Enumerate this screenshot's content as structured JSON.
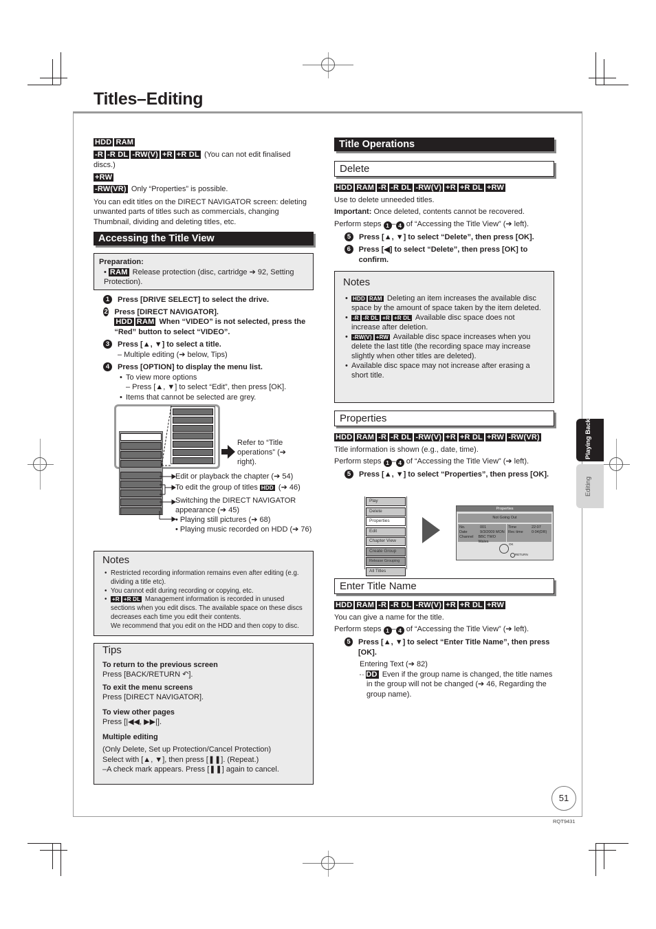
{
  "page": {
    "title": "Titles–Editing",
    "page_number": "51",
    "doc_code": "RQT9431"
  },
  "side_tabs": [
    {
      "label": "Playing Back",
      "active": true
    },
    {
      "label": "Editing",
      "active": false
    }
  ],
  "left": {
    "intro": {
      "row1_tags": [
        "HDD",
        "RAM"
      ],
      "row2_tags": [
        "-R",
        "-R DL",
        "-RW(V)",
        "+R",
        "+R DL"
      ],
      "row2_text": "(You can not edit finalised discs.)",
      "row3_tags": [
        "+RW"
      ],
      "row4_tags": [
        "-RW(VR)"
      ],
      "row4_text": "Only “Properties” is possible.",
      "paragraph": "You can edit titles on the DIRECT NAVIGATOR screen: deleting unwanted parts of titles such as commercials, changing Thumbnail, dividing and deleting titles, etc."
    },
    "accessing": {
      "heading": "Accessing the Title View",
      "preparation_label": "Preparation:",
      "preparation_tag": "RAM",
      "preparation_text": "Release protection (disc, cartridge ➔ 92, Setting Protection).",
      "steps": [
        {
          "n": "1",
          "text": "Press [DRIVE SELECT] to select the drive."
        },
        {
          "n": "2",
          "text": "Press [DIRECT NAVIGATOR].",
          "sub_tags": [
            "HDD",
            "RAM"
          ],
          "sub_text": "When “VIDEO” is not selected, press the “Red” button to select “VIDEO”."
        },
        {
          "n": "3",
          "text": "Press [▲, ▼] to select a title.",
          "note": "– Multiple editing (➔ below, Tips)"
        },
        {
          "n": "4",
          "text": "Press [OPTION] to display the menu list.",
          "bullets": [
            "To view more options",
            "– Press [▲, ▼] to select “Edit”, then press [OK].",
            "Items that cannot be selected are grey."
          ]
        }
      ],
      "diagram": {
        "refer_text": "Refer to “Title operations” (➔ right).",
        "callouts": [
          "Edit or playback the chapter (➔ 54)",
          "To edit the group of titles",
          "Switching the DIRECT NAVIGATOR appearance (➔ 45)",
          "• Playing still pictures (➔ 68)",
          "• Playing music recorded on HDD (➔ 76)"
        ],
        "group_tag": "HDD",
        "group_ref": "(➔ 46)"
      }
    },
    "notes": {
      "heading": "Notes",
      "items": [
        {
          "text": "Restricted recording information remains even after editing (e.g. dividing a title etc)."
        },
        {
          "text": "You cannot edit during recording or copying, etc."
        },
        {
          "tags": [
            "+R",
            "+R DL"
          ],
          "text": "Management information is recorded in unused sections when you edit discs. The available space on these discs decreases each time you edit their contents.",
          "extra": "We recommend that you edit on the HDD and then copy to disc."
        }
      ]
    },
    "tips": {
      "heading": "Tips",
      "items": [
        {
          "title": "To return to the previous screen",
          "text": "Press [BACK/RETURN ↶]."
        },
        {
          "title": "To exit the menu screens",
          "text": "Press [DIRECT NAVIGATOR]."
        },
        {
          "title": "To view other pages",
          "text": "Press [|◀◀, ▶▶|]."
        },
        {
          "title": "Multiple editing",
          "text": "(Only Delete, Set up Protection/Cancel Protection)",
          "text2": "Select with [▲, ▼], then press [❚❚]. (Repeat.)",
          "text3": "–A check mark appears. Press [❚❚] again to cancel."
        }
      ]
    }
  },
  "right": {
    "heading": "Title Operations",
    "perform_prefix": "Perform steps",
    "perform_range_from": "1",
    "perform_range_to": "4",
    "perform_suffix": "of “Accessing the Title View” (➔ left).",
    "delete": {
      "heading": "Delete",
      "tags": [
        "HDD",
        "RAM",
        "-R",
        "-R DL",
        "-RW(V)",
        "+R",
        "+R DL",
        "+RW"
      ],
      "desc": "Use to delete unneeded titles.",
      "important_label": "Important:",
      "important_text": "Once deleted, contents cannot be recovered.",
      "steps": [
        {
          "n": "5",
          "text": "Press [▲, ▼] to select “Delete”, then press [OK]."
        },
        {
          "n": "6",
          "text": "Press [◀] to select “Delete”, then press [OK] to confirm."
        }
      ],
      "notes": {
        "heading": "Notes",
        "items": [
          {
            "tags": [
              "HDD",
              "RAM"
            ],
            "text": "Deleting an item increases the available disc space by the amount of space taken by the item deleted."
          },
          {
            "tags": [
              "-R",
              "-R DL",
              "+R",
              "+R DL"
            ],
            "text": "Available disc space does not increase after deletion."
          },
          {
            "tags": [
              "-RW(V)",
              "+RW"
            ],
            "text": "Available disc space increases when you delete the last title (the recording space may increase slightly when other titles are deleted)."
          },
          {
            "tags": [],
            "text": "Available disc space may not increase after erasing a short title."
          }
        ]
      }
    },
    "properties": {
      "heading": "Properties",
      "tags": [
        "HDD",
        "RAM",
        "-R",
        "-R DL",
        "-RW(V)",
        "+R",
        "+R DL",
        "+RW",
        "-RW(VR)"
      ],
      "desc": "Title information is shown (e.g., date, time).",
      "steps": [
        {
          "n": "5",
          "text": "Press [▲, ▼] to select “Properties”, then press [OK]."
        }
      ],
      "menu_items": [
        "Play",
        "Delete",
        "Properties",
        "Edit",
        "Chapter View",
        "Create Group",
        "Release Grouping",
        "All Titles"
      ],
      "selected_menu_item": "Properties",
      "screen": {
        "title": "Properties",
        "name": "Not Going Out",
        "left_fields": [
          {
            "label": "No.",
            "value": "001"
          },
          {
            "label": "Date",
            "value": "9/3/2009 MON"
          },
          {
            "label": "Channel",
            "value": "BBC TWO Wales"
          }
        ],
        "right_fields": [
          {
            "label": "Time",
            "value": "22:07"
          },
          {
            "label": "Rec time",
            "value": "0:04(DR)"
          }
        ],
        "ok_label": "OK",
        "return_label": "RETURN"
      }
    },
    "enter_title": {
      "heading": "Enter Title Name",
      "tags": [
        "HDD",
        "RAM",
        "-R",
        "-R DL",
        "-RW(V)",
        "+R",
        "+R DL",
        "+RW"
      ],
      "desc": "You can give a name for the title.",
      "steps": [
        {
          "n": "5",
          "text": "Press [▲, ▼] to select “Enter Title Name”, then press [OK]."
        }
      ],
      "entering_text": "Entering Text (➔ 82)",
      "hdd_note_tag": "HDD",
      "hdd_note": "Even if the group name is changed, the title names in the group will not be changed (➔ 46, Regarding the group name)."
    }
  }
}
